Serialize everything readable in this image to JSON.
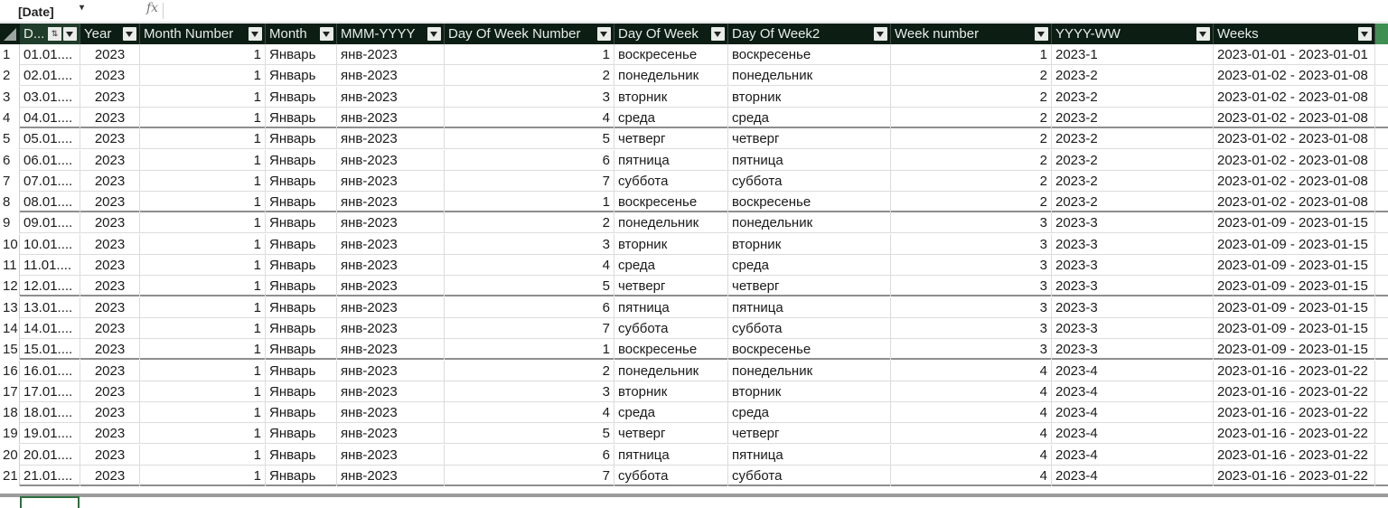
{
  "formula_bar": {
    "name_box": "[Date]",
    "name_box_arrow": "▾",
    "fx_label": "fx",
    "value": ""
  },
  "columns": [
    {
      "key": "date",
      "label": "D..."
    },
    {
      "key": "year",
      "label": "Year"
    },
    {
      "key": "month_number",
      "label": "Month Number"
    },
    {
      "key": "month",
      "label": "Month"
    },
    {
      "key": "mmm_yyyy",
      "label": "MMM-YYYY"
    },
    {
      "key": "dow_number",
      "label": "Day Of Week Number"
    },
    {
      "key": "dow",
      "label": "Day Of Week"
    },
    {
      "key": "dow2",
      "label": "Day Of Week2"
    },
    {
      "key": "week_number",
      "label": "Week number"
    },
    {
      "key": "yyyy_ww",
      "label": "YYYY-WW"
    },
    {
      "key": "weeks",
      "label": "Weeks"
    }
  ],
  "icons": {
    "filter": "filter-dropdown-icon",
    "sort": "sort-icon"
  },
  "rows": [
    [
      "1",
      "01.01....",
      "2023",
      "1",
      "Январь",
      "янв-2023",
      "1",
      "воскресенье",
      "воскресенье",
      "1",
      "2023-1",
      "2023-01-01 - 2023-01-01"
    ],
    [
      "2",
      "02.01....",
      "2023",
      "1",
      "Январь",
      "янв-2023",
      "2",
      "понедельник",
      "понедельник",
      "2",
      "2023-2",
      "2023-01-02 - 2023-01-08"
    ],
    [
      "3",
      "03.01....",
      "2023",
      "1",
      "Январь",
      "янв-2023",
      "3",
      "вторник",
      "вторник",
      "2",
      "2023-2",
      "2023-01-02 - 2023-01-08"
    ],
    [
      "4",
      "04.01....",
      "2023",
      "1",
      "Январь",
      "янв-2023",
      "4",
      "среда",
      "среда",
      "2",
      "2023-2",
      "2023-01-02 - 2023-01-08"
    ],
    [
      "5",
      "05.01....",
      "2023",
      "1",
      "Январь",
      "янв-2023",
      "5",
      "четверг",
      "четверг",
      "2",
      "2023-2",
      "2023-01-02 - 2023-01-08"
    ],
    [
      "6",
      "06.01....",
      "2023",
      "1",
      "Январь",
      "янв-2023",
      "6",
      "пятница",
      "пятница",
      "2",
      "2023-2",
      "2023-01-02 - 2023-01-08"
    ],
    [
      "7",
      "07.01....",
      "2023",
      "1",
      "Январь",
      "янв-2023",
      "7",
      "суббота",
      "суббота",
      "2",
      "2023-2",
      "2023-01-02 - 2023-01-08"
    ],
    [
      "8",
      "08.01....",
      "2023",
      "1",
      "Январь",
      "янв-2023",
      "1",
      "воскресенье",
      "воскресенье",
      "2",
      "2023-2",
      "2023-01-02 - 2023-01-08"
    ],
    [
      "9",
      "09.01....",
      "2023",
      "1",
      "Январь",
      "янв-2023",
      "2",
      "понедельник",
      "понедельник",
      "3",
      "2023-3",
      "2023-01-09 - 2023-01-15"
    ],
    [
      "10",
      "10.01....",
      "2023",
      "1",
      "Январь",
      "янв-2023",
      "3",
      "вторник",
      "вторник",
      "3",
      "2023-3",
      "2023-01-09 - 2023-01-15"
    ],
    [
      "11",
      "11.01....",
      "2023",
      "1",
      "Январь",
      "янв-2023",
      "4",
      "среда",
      "среда",
      "3",
      "2023-3",
      "2023-01-09 - 2023-01-15"
    ],
    [
      "12",
      "12.01....",
      "2023",
      "1",
      "Январь",
      "янв-2023",
      "5",
      "четверг",
      "четверг",
      "3",
      "2023-3",
      "2023-01-09 - 2023-01-15"
    ],
    [
      "13",
      "13.01....",
      "2023",
      "1",
      "Январь",
      "янв-2023",
      "6",
      "пятница",
      "пятница",
      "3",
      "2023-3",
      "2023-01-09 - 2023-01-15"
    ],
    [
      "14",
      "14.01....",
      "2023",
      "1",
      "Январь",
      "янв-2023",
      "7",
      "суббота",
      "суббота",
      "3",
      "2023-3",
      "2023-01-09 - 2023-01-15"
    ],
    [
      "15",
      "15.01....",
      "2023",
      "1",
      "Январь",
      "янв-2023",
      "1",
      "воскресенье",
      "воскресенье",
      "3",
      "2023-3",
      "2023-01-09 - 2023-01-15"
    ],
    [
      "16",
      "16.01....",
      "2023",
      "1",
      "Январь",
      "янв-2023",
      "2",
      "понедельник",
      "понедельник",
      "4",
      "2023-4",
      "2023-01-16 - 2023-01-22"
    ],
    [
      "17",
      "17.01....",
      "2023",
      "1",
      "Январь",
      "янв-2023",
      "3",
      "вторник",
      "вторник",
      "4",
      "2023-4",
      "2023-01-16 - 2023-01-22"
    ],
    [
      "18",
      "18.01....",
      "2023",
      "1",
      "Январь",
      "янв-2023",
      "4",
      "среда",
      "среда",
      "4",
      "2023-4",
      "2023-01-16 - 2023-01-22"
    ],
    [
      "19",
      "19.01....",
      "2023",
      "1",
      "Январь",
      "янв-2023",
      "5",
      "четверг",
      "четверг",
      "4",
      "2023-4",
      "2023-01-16 - 2023-01-22"
    ],
    [
      "20",
      "20.01....",
      "2023",
      "1",
      "Январь",
      "янв-2023",
      "6",
      "пятница",
      "пятница",
      "4",
      "2023-4",
      "2023-01-16 - 2023-01-22"
    ],
    [
      "21",
      "21.01....",
      "2023",
      "1",
      "Январь",
      "янв-2023",
      "7",
      "суббота",
      "суббота",
      "4",
      "2023-4",
      "2023-01-16 - 2023-01-22"
    ]
  ]
}
